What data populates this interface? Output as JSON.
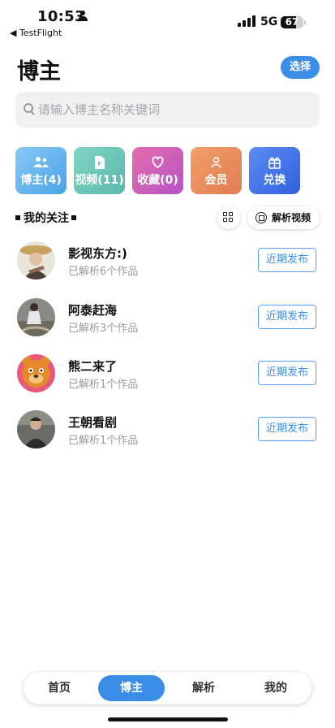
{
  "status_bar": {
    "time": "10:53",
    "back_app": "◀ TestFlight",
    "network": "5G",
    "battery": "67",
    "battery_level": 0.67
  },
  "header": {
    "title": "博主",
    "select_label": "选择"
  },
  "search": {
    "placeholder": "请输入博主名称关键词"
  },
  "tiles": [
    {
      "label": "博主(4)",
      "icon": "people-icon"
    },
    {
      "label": "视频(11)",
      "icon": "video-file-icon"
    },
    {
      "label": "收藏(0)",
      "icon": "heart-icon"
    },
    {
      "label": "会员",
      "icon": "person-icon"
    },
    {
      "label": "兑换",
      "icon": "gift-icon"
    }
  ],
  "section": {
    "title": "我的关注",
    "parse_label": "解析视频"
  },
  "bloggers": [
    {
      "name": "影视东方:)",
      "sub": "已解析6个作品",
      "button": "近期发布"
    },
    {
      "name": "阿泰赶海",
      "sub": "已解析3个作品",
      "button": "近期发布"
    },
    {
      "name": "熊二来了",
      "sub": "已解析1个作品",
      "button": "近期发布"
    },
    {
      "name": "王朝看剧",
      "sub": "已解析1个作品",
      "button": "近期发布"
    }
  ],
  "tabbar": {
    "items": [
      "首页",
      "博主",
      "解析",
      "我的"
    ],
    "active": "博主"
  },
  "colors": {
    "accent": "#3b8ee8"
  }
}
